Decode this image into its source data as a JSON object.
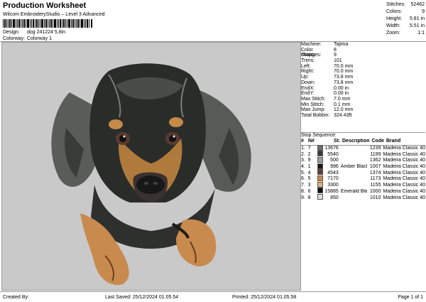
{
  "header": {
    "title": "Production Worksheet",
    "subtitle": "Wilcom EmbroideryStudio – Level 3 Advanced",
    "design_label": "Design:",
    "design_value": "dog 241224 5,8in",
    "colorway_label": "Colorway:",
    "colorway_value": "Colorway 1"
  },
  "stats": [
    {
      "label": "Stitches:",
      "value": "52462"
    },
    {
      "label": "Colors:",
      "value": "9"
    },
    {
      "label": "Height:",
      "value": "5.81 in"
    },
    {
      "label": "Width:",
      "value": "5.51 in"
    },
    {
      "label": "Zoom:",
      "value": "1:1"
    }
  ],
  "machine_info": [
    {
      "label": "Machine:",
      "value": "Tajima"
    },
    {
      "label": "Color changes:",
      "value": "8"
    },
    {
      "label": "Stops:",
      "value": "9"
    },
    {
      "label": "Trims:",
      "value": "101"
    },
    {
      "label": "Left:",
      "value": "70.0 mm"
    },
    {
      "label": "Right:",
      "value": "70.0 mm"
    },
    {
      "label": "Up:",
      "value": "73.8 mm"
    },
    {
      "label": "Down:",
      "value": "73.8 mm"
    },
    {
      "label": "EndX:",
      "value": "0.00 in"
    },
    {
      "label": "EndY:",
      "value": "0.00 in"
    },
    {
      "label": "Max Stitch:",
      "value": "7.0 mm"
    },
    {
      "label": "Min Stitch:",
      "value": "0.1 mm"
    },
    {
      "label": "Max Jump:",
      "value": "12.0 mm"
    },
    {
      "label": "Total Bobbin:",
      "value": "324.43ft"
    }
  ],
  "stop_sequence": {
    "title": "Stop Sequence:",
    "columns": {
      "no": "#",
      "n": "N#",
      "st": "St.",
      "desc": "Description",
      "code": "Code",
      "brand": "Brand"
    },
    "rows": [
      {
        "no": "1.",
        "n": "7",
        "color": "#6b6b6b",
        "st": "13676",
        "desc": "",
        "code": "1239",
        "brand": "Madeira Classic 40"
      },
      {
        "no": "2.",
        "n": "2",
        "color": "#3b3b3b",
        "st": "5540",
        "desc": "",
        "code": "1199",
        "brand": "Madeira Classic 40"
      },
      {
        "no": "3.",
        "n": "9",
        "color": "#9c9c9c",
        "st": "500",
        "desc": "",
        "code": "1362",
        "brand": "Madeira Classic 40"
      },
      {
        "no": "4.",
        "n": "1",
        "color": "#1a1a1a",
        "st": "996",
        "desc": "Amber Black",
        "code": "1007",
        "brand": "Madeira Classic 40"
      },
      {
        "no": "5.",
        "n": "4",
        "color": "#6a3a38",
        "st": "4543",
        "desc": "",
        "code": "1374",
        "brand": "Madeira Classic 40"
      },
      {
        "no": "6.",
        "n": "5",
        "color": "#c98a4e",
        "st": "7170",
        "desc": "",
        "code": "1173",
        "brand": "Madeira Classic 40"
      },
      {
        "no": "7.",
        "n": "3",
        "color": "#e0b07a",
        "st": "3300",
        "desc": "",
        "code": "1155",
        "brand": "Madeira Classic 40"
      },
      {
        "no": "8.",
        "n": "6",
        "color": "#111111",
        "st": "15885",
        "desc": "Emerald Black",
        "code": "1000",
        "brand": "Madeira Classic 40"
      },
      {
        "no": "9.",
        "n": "8",
        "color": "#dcdcdc",
        "st": "850",
        "desc": "",
        "code": "1010",
        "brand": "Madeira Classic 40"
      }
    ]
  },
  "footer": {
    "created": "Created By:",
    "saved": "Last Saved: 25/12/2024 01.05.54",
    "printed": "Printed: 25/12/2024 01.05.58",
    "page": "Page 1 of 1"
  }
}
